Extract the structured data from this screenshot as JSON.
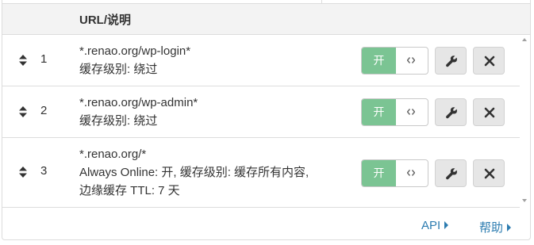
{
  "header": {
    "column_label": "URL/说明"
  },
  "rules": [
    {
      "number": "1",
      "url": "*.renao.org/wp-login*",
      "description_lines": [
        "缓存级别: 绕过"
      ],
      "toggle_label": "开",
      "enabled": true
    },
    {
      "number": "2",
      "url": "*.renao.org/wp-admin*",
      "description_lines": [
        "缓存级别: 绕过"
      ],
      "toggle_label": "开",
      "enabled": true
    },
    {
      "number": "3",
      "url": "*.renao.org/*",
      "description_lines": [
        "Always Online: 开, 缓存级别: 缓存所有内容,",
        "边缘缓存 TTL: 7 天"
      ],
      "toggle_label": "开",
      "enabled": true
    }
  ],
  "icons": {
    "drag": "sort-arrows-icon",
    "toggle_knob": "code-arrows-icon",
    "edit": "wrench-icon",
    "delete": "close-icon"
  },
  "footer": {
    "api_label": "API",
    "help_label": "帮助"
  },
  "colors": {
    "toggle_on": "#7bc493",
    "link": "#2c7cb0",
    "button_bg": "#e6e6e6",
    "header_bg": "#f3f3f3"
  }
}
